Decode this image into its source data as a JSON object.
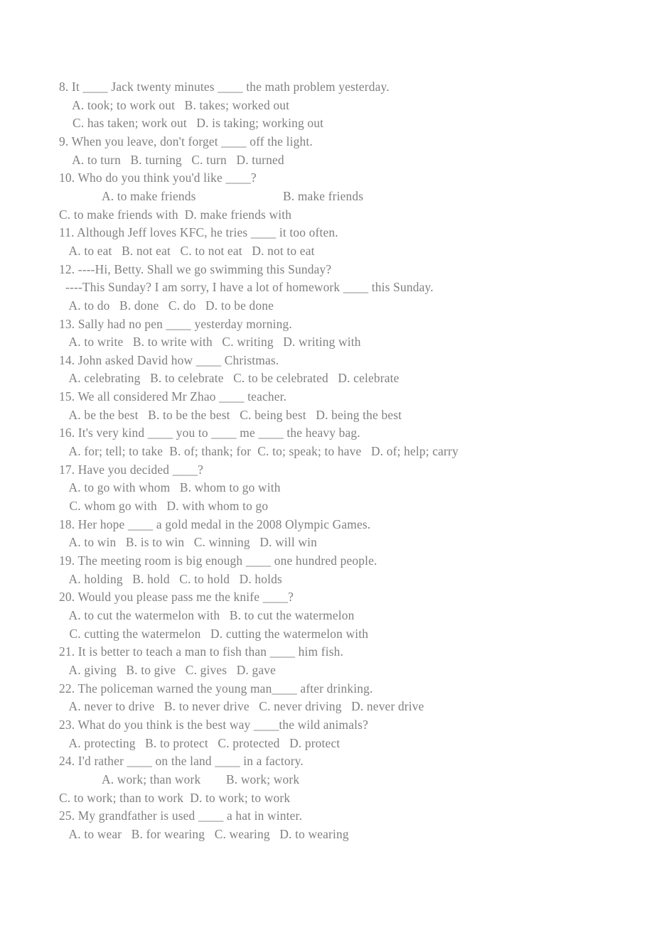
{
  "document": {
    "type": "english-grammar-worksheet",
    "text_color": "#808080",
    "background_color": "#ffffff",
    "blank": "____"
  },
  "items": [
    {
      "number": "8",
      "stem": "8. It ____ Jack twenty minutes ____ the math problem yesterday.",
      "option_lines": [
        "  A. took; to work out   B. takes; worked out",
        "  C. has taken; work out   D. is taking; working out"
      ]
    },
    {
      "number": "9",
      "stem": "9. When you leave, don't forget ____ off the light.",
      "option_lines": [
        "  A. to turn   B. turning   C. turn   D. turned"
      ]
    },
    {
      "number": "10",
      "stem": "10. Who do you think you'd like ____?",
      "split": {
        "a": "A. to make friends",
        "b": "B. make friends"
      },
      "option_lines_flush": [
        "C. to make friends with  D. make friends with"
      ]
    },
    {
      "number": "11",
      "stem": "11. Although Jeff loves KFC, he tries ____ it too often.",
      "option_lines": [
        " A. to eat   B. not eat   C. to not eat   D. not to eat"
      ]
    },
    {
      "number": "12",
      "stem": "12. ----Hi, Betty. Shall we go swimming this Sunday?",
      "stem_line2": "  ----This Sunday? I am sorry, I have a lot of homework ____ this Sunday.",
      "option_lines": [
        " A. to do   B. done   C. do   D. to be done"
      ]
    },
    {
      "number": "13",
      "stem": "13. Sally had no pen ____ yesterday morning.",
      "option_lines": [
        " A. to write   B. to write with   C. writing   D. writing with"
      ]
    },
    {
      "number": "14",
      "stem": "14. John asked David how ____ Christmas.",
      "option_lines": [
        " A. celebrating   B. to celebrate   C. to be celebrated   D. celebrate"
      ]
    },
    {
      "number": "15",
      "stem": "15. We all considered Mr Zhao ____ teacher.",
      "option_lines": [
        " A. be the best   B. to be the best   C. being best   D. being the best"
      ]
    },
    {
      "number": "16",
      "stem": "16. It's very kind ____ you to ____ me ____ the heavy bag.",
      "option_lines": [
        " A. for; tell; to take  B. of; thank; for  C. to; speak; to have   D. of; help; carry"
      ]
    },
    {
      "number": "17",
      "stem": "17. Have you decided ____?",
      "option_lines": [
        " A. to go with whom   B. whom to go with",
        " C. whom go with   D. with whom to go"
      ]
    },
    {
      "number": "18",
      "stem": "18. Her hope ____ a gold medal in the 2008 Olympic Games.",
      "option_lines": [
        " A. to win   B. is to win   C. winning   D. will win"
      ]
    },
    {
      "number": "19",
      "stem": "19. The meeting room is big enough ____ one hundred people.",
      "option_lines": [
        " A. holding   B. hold   C. to hold   D. holds"
      ]
    },
    {
      "number": "20",
      "stem": "20. Would you please pass me the knife ____?",
      "option_lines": [
        " A. to cut the watermelon with   B. to cut the watermelon",
        " C. cutting the watermelon   D. cutting the watermelon with"
      ]
    },
    {
      "number": "21",
      "stem": "21. It is better to teach a man to fish than ____ him fish.",
      "option_lines": [
        " A. giving   B. to give   C. gives   D. gave"
      ]
    },
    {
      "number": "22",
      "stem": "22. The policeman warned the young man____ after drinking.",
      "option_lines": [
        " A. never to drive   B. to never drive   C. never driving   D. never drive"
      ]
    },
    {
      "number": "23",
      "stem": "23. What do you think is the best way ____the wild animals?",
      "option_lines": [
        " A. protecting   B. to protect   C. protected   D. protect"
      ]
    },
    {
      "number": "24",
      "stem": "24. I'd rather ____ on the land ____ in a factory.",
      "split": {
        "a": "A. work; than work",
        "b": "B. work; work"
      },
      "option_lines_flush": [
        "C. to work; than to work  D. to work; to work"
      ]
    },
    {
      "number": "25",
      "stem": "25. My grandfather is used ____ a hat in winter.",
      "option_lines": [
        " A. to wear   B. for wearing   C. wearing   D. to wearing"
      ]
    }
  ]
}
